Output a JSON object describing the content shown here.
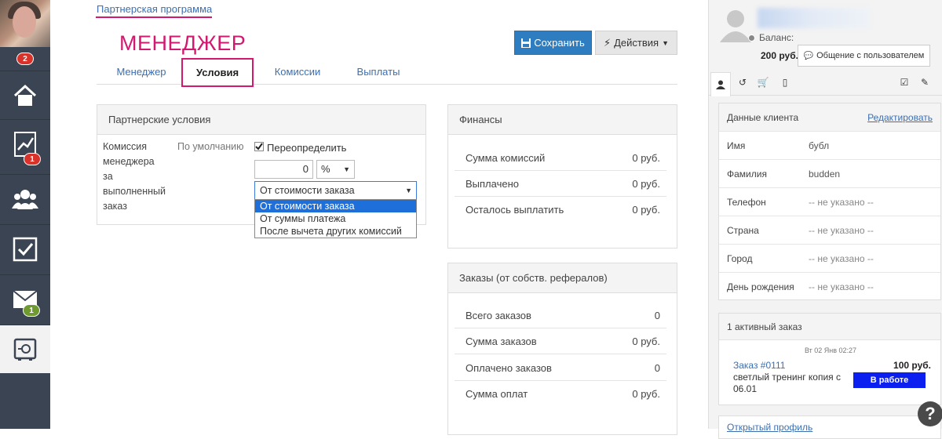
{
  "nav": {
    "avatar_badge": "2",
    "items": [
      {
        "icon": "home-icon"
      },
      {
        "icon": "chart-icon",
        "badge": "1"
      },
      {
        "icon": "users-icon"
      },
      {
        "icon": "checkbox-icon"
      },
      {
        "icon": "mail-icon",
        "badge": "1"
      },
      {
        "icon": "safe-icon"
      }
    ]
  },
  "header": {
    "breadcrumb": "Партнерская программа",
    "title": "МЕНЕДЖЕР",
    "save_label": "Сохранить",
    "actions_label": "Действия"
  },
  "tabs": [
    "Менеджер",
    "Условия",
    "Комиссии",
    "Выплаты"
  ],
  "active_tab": "Условия",
  "terms": {
    "title": "Партнерские условия",
    "row_label_lines": [
      "Комиссия",
      "менеджера",
      "за",
      "выполненный",
      "заказ"
    ],
    "default_label": "По умолчанию",
    "override_label": "Переопределить",
    "override_checked": true,
    "amount_value": "0",
    "unit_value": "%",
    "base_value": "От стоимости заказа",
    "base_options": [
      "От стоимости заказа",
      "От суммы платежа",
      "После вычета других комиссий"
    ]
  },
  "finance": {
    "title": "Финансы",
    "rows": [
      {
        "label": "Сумма комиссий",
        "value": "0 руб."
      },
      {
        "label": "Выплачено",
        "value": "0 руб."
      },
      {
        "label": "Осталось выплатить",
        "value": "0 руб."
      }
    ]
  },
  "orders": {
    "title": "Заказы (от собств. рефералов)",
    "rows": [
      {
        "label": "Всего заказов",
        "value": "0"
      },
      {
        "label": "Сумма заказов",
        "value": "0 руб."
      },
      {
        "label": "Оплачено заказов",
        "value": "0"
      },
      {
        "label": "Сумма оплат",
        "value": "0 руб."
      }
    ]
  },
  "user": {
    "balance_label": "Баланс:",
    "balance_value": "200 руб.",
    "chat_button": "Общение с пользователем"
  },
  "client": {
    "title": "Данные клиента",
    "edit_label": "Редактировать",
    "rows": [
      {
        "label": "Имя",
        "value": "бубл"
      },
      {
        "label": "Фамилия",
        "value": "budden"
      },
      {
        "label": "Телефон",
        "value": "-- не указано --"
      },
      {
        "label": "Страна",
        "value": "-- не указано --"
      },
      {
        "label": "Город",
        "value": "-- не указано --"
      },
      {
        "label": "День рождения",
        "value": "-- не указано --"
      }
    ]
  },
  "active_orders": {
    "title": "1 активный заказ",
    "date": "Вт 02 Янв 02:27",
    "order_link": "Заказ #0111",
    "order_price": "100 руб.",
    "order_desc": "светлый тренинг копия с 06.01",
    "status": "В работе"
  },
  "open_profile": "Открытый профиль",
  "colors": {
    "accent_pink": "#d3186f",
    "primary_blue": "#2f7dc1",
    "status_blue": "#0a1ff0",
    "badge_red": "#d9322b",
    "badge_green": "#6f9a2f"
  }
}
